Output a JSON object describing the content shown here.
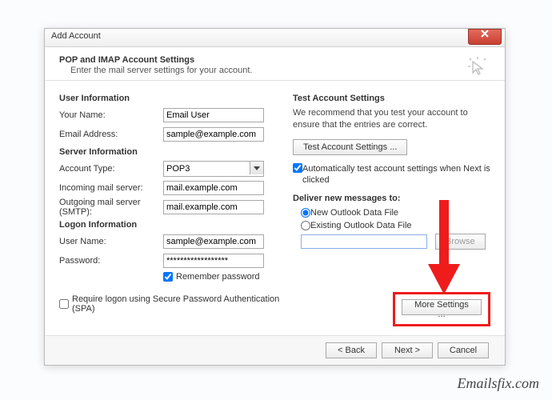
{
  "dialog": {
    "title": "Add Account",
    "pageTitle": "POP and IMAP Account Settings",
    "pageSub": "Enter the mail server settings for your account."
  },
  "sections": {
    "userInfo": "User Information",
    "serverInfo": "Server Information",
    "logonInfo": "Logon Information"
  },
  "labels": {
    "yourName": "Your Name:",
    "emailAddress": "Email Address:",
    "accountType": "Account Type:",
    "incoming": "Incoming mail server:",
    "outgoing": "Outgoing mail server (SMTP):",
    "userName": "User Name:",
    "password": "Password:",
    "rememberPassword": "Remember password",
    "spa": "Require logon using Secure Password Authentication (SPA)"
  },
  "values": {
    "yourName": "Email User",
    "emailAddress": "sample@example.com",
    "accountType": "POP3",
    "incoming": "mail.example.com",
    "outgoing": "mail.example.com",
    "userName": "sample@example.com",
    "password": "******************",
    "rememberPassword": true,
    "spa": false
  },
  "right": {
    "testTitle": "Test Account Settings",
    "testDesc": "We recommend that you test your account to ensure that the entries are correct.",
    "testButton": "Test Account Settings ...",
    "autoTest": "Automatically test account settings when Next is clicked",
    "autoTestChecked": true,
    "deliverTitle": "Deliver new messages to:",
    "radioNew": "New Outlook Data File",
    "radioExisting": "Existing Outlook Data File",
    "radioSelected": "new",
    "browsePath": "",
    "browseButton": "Browse",
    "moreSettings": "More Settings ..."
  },
  "footer": {
    "back": "< Back",
    "next": "Next >",
    "cancel": "Cancel"
  },
  "watermark": "Emailsfix.com"
}
